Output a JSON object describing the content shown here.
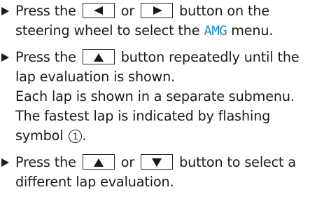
{
  "step1": {
    "line1": {
      "before": "Press the",
      "between": "or",
      "after": "button on the"
    },
    "line2": {
      "before": "steering wheel to select the",
      "highlight": "AMG",
      "after": "menu."
    },
    "highlight_color": "#1a8fd6"
  },
  "step2": {
    "line1": {
      "before": "Press the",
      "after": "button repeatedly until the"
    },
    "line2": "lap evaluation is shown.",
    "line3": "Each lap is shown in a separate submenu.",
    "line4": "The fastest lap is indicated by flashing",
    "line5": {
      "before": "symbol",
      "symbol": "1",
      "after": "."
    }
  },
  "step3": {
    "line1": {
      "before": "Press the",
      "between": "or",
      "after": "button to select a"
    },
    "line2": "different lap evaluation."
  },
  "icons": {
    "bullet": "triangle-right-bullet",
    "key_left": "left-arrow-key-icon",
    "key_right": "right-arrow-key-icon",
    "key_up": "up-arrow-key-icon",
    "key_down": "down-arrow-key-icon",
    "symbol": "circled-number-icon"
  }
}
